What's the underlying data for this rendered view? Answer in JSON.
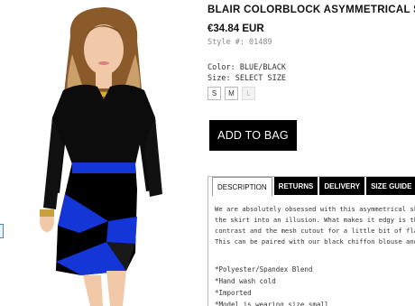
{
  "product": {
    "title": "BLAIR COLORBLOCK ASYMMETRICAL SKIRT",
    "price": "€34.84 EUR",
    "style_no": "Style #: 01489",
    "color": "Color: BLUE/BLACK",
    "size_label": "Size: SELECT SIZE",
    "sizes": [
      {
        "label": "S",
        "available": true
      },
      {
        "label": "M",
        "available": true
      },
      {
        "label": "L",
        "available": false
      }
    ],
    "add_to_bag": "ADD TO BAG"
  },
  "tabs": [
    "DESCRIPTION",
    "RETURNS",
    "DELIVERY",
    "SIZE GUIDE"
  ],
  "active_tab": "DESCRIPTION",
  "description": {
    "lines": [
      "We are absolutely obsessed with this asymmetrical skirt! Its",
      "the skirt into an illusion. What makes it edgy is the bold ele",
      "contrast and the mesh cutout for a little bit of flair. This s",
      "This can be paired with our black chiffon blouse and any c"
    ],
    "bullets": [
      "*Polyester/Spandex Blend",
      "*Hand wash cold",
      "*Imported",
      "*Model is wearing size small"
    ]
  },
  "colors": {
    "skirt_blue": "#1536d6",
    "black": "#000000",
    "tab_active_bg": "#ffffff"
  },
  "icons": {
    "photo": "model-photo"
  }
}
